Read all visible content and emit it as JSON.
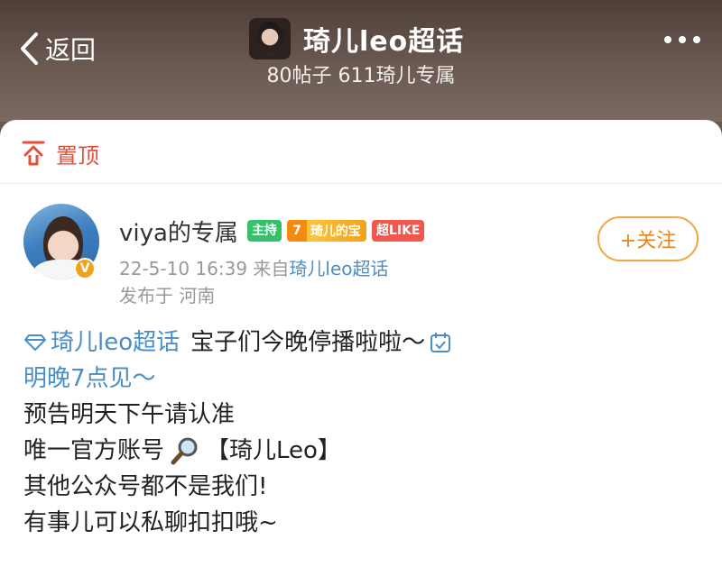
{
  "header": {
    "back_label": "返回",
    "title": "琦儿leo超话",
    "subtitle": "80帖子 611琦儿专属"
  },
  "pinned": {
    "label": "置顶"
  },
  "post": {
    "username": "viya的专属",
    "tags": {
      "host": "主持",
      "fan_level": "7",
      "fan_label": "琦儿的宝",
      "super_like": "超LIKE"
    },
    "follow_label": "+关注",
    "date": "22-5-10 16:39",
    "from_prefix": "来自",
    "from_link": "琦儿leo超话",
    "location": "发布于 河南",
    "topic_link": "琦儿leo超话",
    "lines": {
      "line1_text": "宝子们今晚停播啦啦～",
      "line2_text": "明晚7点见～",
      "line3_text": "预告明天下午请认准",
      "line4_text": "唯一官方账号",
      "line4_account": "【琦儿Leo】",
      "line5_text": "其他公众号都不是我们!",
      "line6_text": "有事儿可以私聊扣扣哦~"
    }
  },
  "colors": {
    "accent_red": "#e0513e",
    "link_blue": "#4a8ec8",
    "follow_orange": "#e8861c"
  }
}
